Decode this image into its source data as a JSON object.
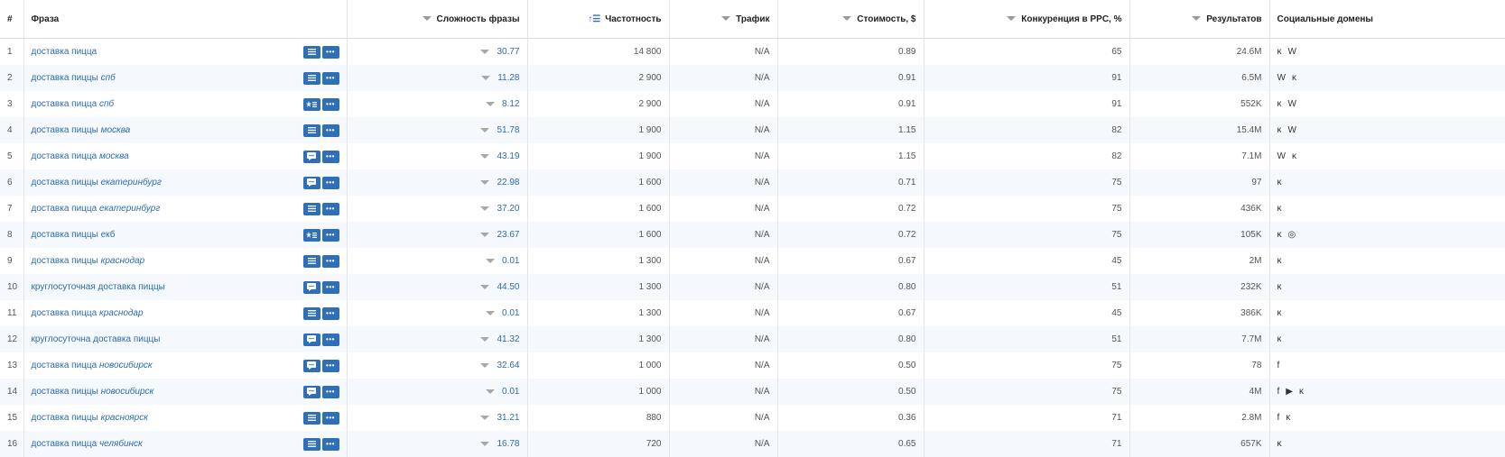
{
  "header": {
    "index": "#",
    "phrase": "Фраза",
    "difficulty": "Сложность фразы",
    "frequency": "Частотность",
    "traffic": "Трафик",
    "cost": "Стоимость, $",
    "competition": "Конкуренция в PPC, %",
    "results": "Результатов",
    "social": "Социальные домены"
  },
  "rows": [
    {
      "idx": "1",
      "base": "доставка пицца",
      "suffix": "",
      "btn": "list",
      "difficulty": "30.77",
      "frequency": "14 800",
      "traffic": "N/A",
      "cost": "0.89",
      "competition": "65",
      "results": "24.6M",
      "social": [
        "vk",
        "wiki"
      ]
    },
    {
      "idx": "2",
      "base": "доставка пиццы",
      "suffix": "спб",
      "btn": "list",
      "difficulty": "11.28",
      "frequency": "2 900",
      "traffic": "N/A",
      "cost": "0.91",
      "competition": "91",
      "results": "6.5M",
      "social": [
        "wiki",
        "vk"
      ]
    },
    {
      "idx": "3",
      "base": "доставка пицца",
      "suffix": "спб",
      "btn": "star",
      "difficulty": "8.12",
      "frequency": "2 900",
      "traffic": "N/A",
      "cost": "0.91",
      "competition": "91",
      "results": "552K",
      "social": [
        "vk",
        "wiki"
      ]
    },
    {
      "idx": "4",
      "base": "доставка пиццы",
      "suffix": "москва",
      "btn": "list",
      "difficulty": "51.78",
      "frequency": "1 900",
      "traffic": "N/A",
      "cost": "1.15",
      "competition": "82",
      "results": "15.4M",
      "social": [
        "vk",
        "wiki"
      ]
    },
    {
      "idx": "5",
      "base": "доставка пицца",
      "suffix": "москва",
      "btn": "chat",
      "difficulty": "43.19",
      "frequency": "1 900",
      "traffic": "N/A",
      "cost": "1.15",
      "competition": "82",
      "results": "7.1M",
      "social": [
        "wiki",
        "vk"
      ]
    },
    {
      "idx": "6",
      "base": "доставка пиццы",
      "suffix": "екатеринбург",
      "btn": "chat",
      "difficulty": "22.98",
      "frequency": "1 600",
      "traffic": "N/A",
      "cost": "0.71",
      "competition": "75",
      "results": "97",
      "social": [
        "vk"
      ]
    },
    {
      "idx": "7",
      "base": "доставка пицца",
      "suffix": "екатеринбург",
      "btn": "list",
      "difficulty": "37.20",
      "frequency": "1 600",
      "traffic": "N/A",
      "cost": "0.72",
      "competition": "75",
      "results": "436K",
      "social": [
        "vk"
      ]
    },
    {
      "idx": "8",
      "base": "доставка пиццы екб",
      "suffix": "",
      "btn": "star",
      "difficulty": "23.67",
      "frequency": "1 600",
      "traffic": "N/A",
      "cost": "0.72",
      "competition": "75",
      "results": "105K",
      "social": [
        "vk",
        "instagram"
      ]
    },
    {
      "idx": "9",
      "base": "доставка пиццы",
      "suffix": "краснодар",
      "btn": "list",
      "difficulty": "0.01",
      "frequency": "1 300",
      "traffic": "N/A",
      "cost": "0.67",
      "competition": "45",
      "results": "2M",
      "social": [
        "vk"
      ]
    },
    {
      "idx": "10",
      "base": "круглосуточная доставка пиццы",
      "suffix": "",
      "btn": "chat",
      "difficulty": "44.50",
      "frequency": "1 300",
      "traffic": "N/A",
      "cost": "0.80",
      "competition": "51",
      "results": "232K",
      "social": [
        "vk"
      ]
    },
    {
      "idx": "11",
      "base": "доставка пицца",
      "suffix": "краснодар",
      "btn": "list",
      "difficulty": "0.01",
      "frequency": "1 300",
      "traffic": "N/A",
      "cost": "0.67",
      "competition": "45",
      "results": "386K",
      "social": [
        "vk"
      ]
    },
    {
      "idx": "12",
      "base": "круглосуточна доставка пиццы",
      "suffix": "",
      "btn": "chat",
      "difficulty": "41.32",
      "frequency": "1 300",
      "traffic": "N/A",
      "cost": "0.80",
      "competition": "51",
      "results": "7.7M",
      "social": [
        "vk"
      ]
    },
    {
      "idx": "13",
      "base": "доставка пицца",
      "suffix": "новосибирск",
      "btn": "chat",
      "difficulty": "32.64",
      "frequency": "1 000",
      "traffic": "N/A",
      "cost": "0.50",
      "competition": "75",
      "results": "78",
      "social": [
        "facebook"
      ]
    },
    {
      "idx": "14",
      "base": "доставка пиццы",
      "suffix": "новосибирск",
      "btn": "chat",
      "difficulty": "0.01",
      "frequency": "1 000",
      "traffic": "N/A",
      "cost": "0.50",
      "competition": "75",
      "results": "4M",
      "social": [
        "facebook",
        "youtube",
        "vk"
      ]
    },
    {
      "idx": "15",
      "base": "доставка пиццы",
      "suffix": "красноярск",
      "btn": "list",
      "difficulty": "31.21",
      "frequency": "880",
      "traffic": "N/A",
      "cost": "0.36",
      "competition": "71",
      "results": "2.8M",
      "social": [
        "facebook",
        "vk"
      ]
    },
    {
      "idx": "16",
      "base": "доставка пицца",
      "suffix": "челябинск",
      "btn": "list",
      "difficulty": "16.78",
      "frequency": "720",
      "traffic": "N/A",
      "cost": "0.65",
      "competition": "71",
      "results": "657K",
      "social": [
        "vk"
      ]
    }
  ],
  "social_glyphs": {
    "vk": "ᴋ",
    "wiki": "W",
    "instagram": "◎",
    "facebook": "f",
    "youtube": "▶"
  },
  "colors": {
    "accent": "#2f6fb8",
    "link": "#2b6cb0",
    "row_alt": "#f5f8fc"
  }
}
